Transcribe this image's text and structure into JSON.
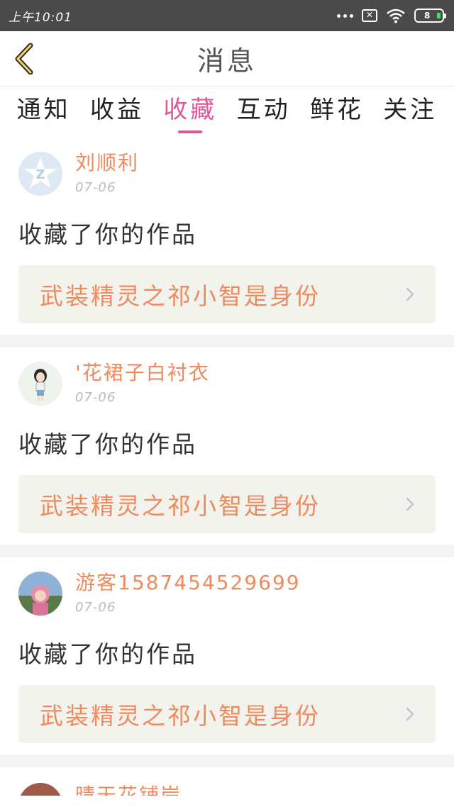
{
  "status_bar": {
    "time": "上午10:01",
    "battery": "8",
    "icons": [
      "more-dots-icon",
      "sim-x-icon",
      "wifi-icon",
      "battery-icon"
    ]
  },
  "header": {
    "title": "消息",
    "back_icon": "chevron-left-icon"
  },
  "tabs": [
    {
      "label": "通知"
    },
    {
      "label": "收益"
    },
    {
      "label": "收藏",
      "active": true
    },
    {
      "label": "互动"
    },
    {
      "label": "鲜花"
    },
    {
      "label": "关注"
    }
  ],
  "notifications": [
    {
      "username": "刘顺利",
      "date": "07-06",
      "action": "收藏了你的作品",
      "work_title": "武装精灵之祁小智是身份"
    },
    {
      "username": "'花裙子白衬衣",
      "date": "07-06",
      "action": "收藏了你的作品",
      "work_title": "武装精灵之祁小智是身份"
    },
    {
      "username": "游客1587454529699",
      "date": "07-06",
      "action": "收藏了你的作品",
      "work_title": "武装精灵之祁小智是身份"
    },
    {
      "username": "晴天花铺岸"
    }
  ],
  "colors": {
    "accent": "#e0579a",
    "name": "#f08a5d",
    "status_bar": "#4a4a4a",
    "work_box": "#f3f3ee"
  }
}
